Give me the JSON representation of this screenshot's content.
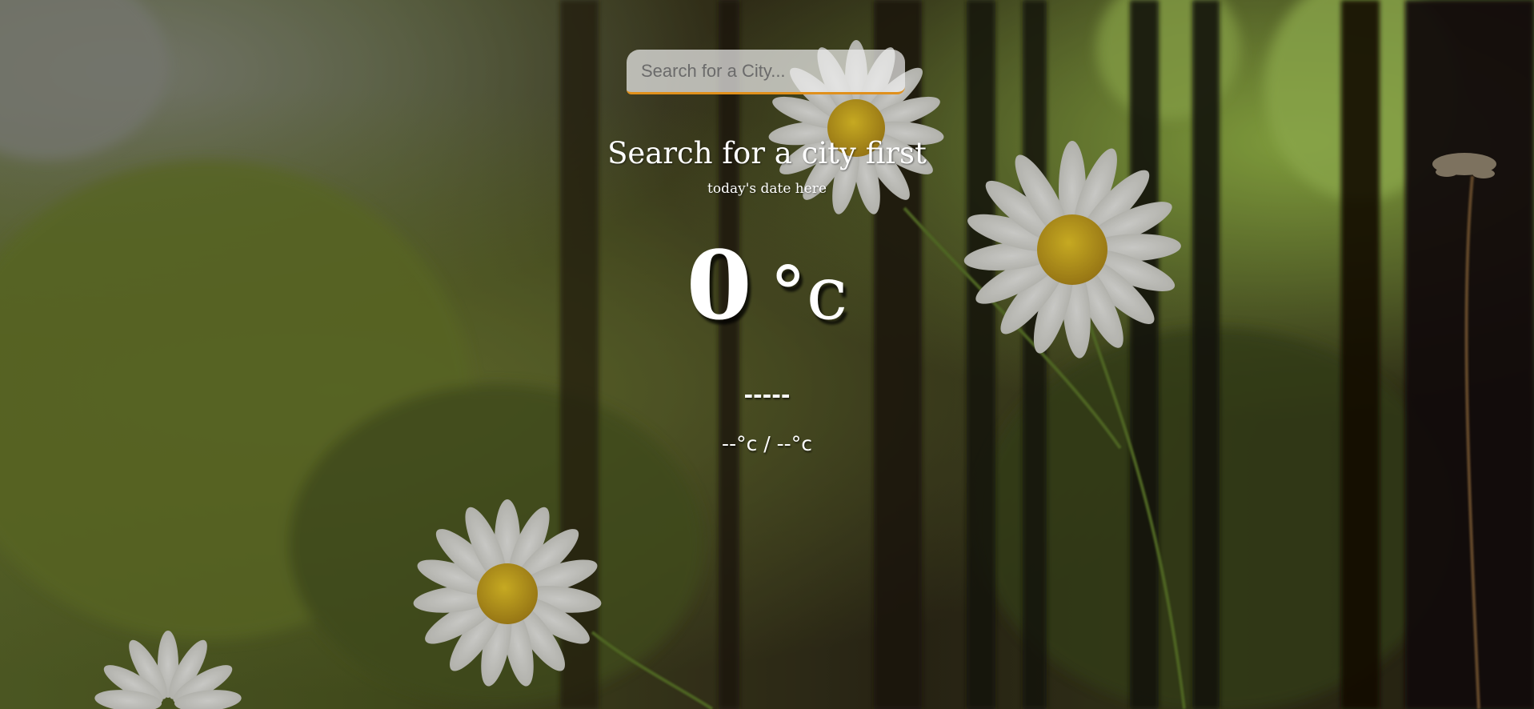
{
  "search": {
    "placeholder": "Search for a City...",
    "value": ""
  },
  "location": {
    "city": "Search for a city first",
    "date": "today's date here"
  },
  "current": {
    "temperature": "0",
    "unit": "°c",
    "description": "-----",
    "hi_lo": "--°c / --°c"
  },
  "colors": {
    "search_accent": "#e0901c",
    "text": "#ffffff"
  }
}
